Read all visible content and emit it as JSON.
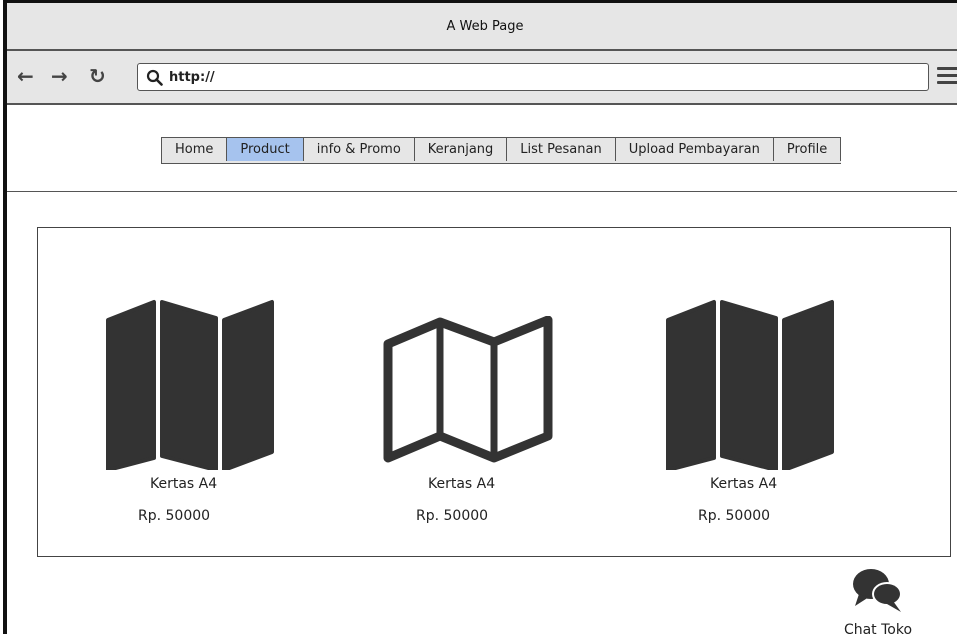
{
  "window": {
    "title": "A Web Page"
  },
  "browser": {
    "url": "http://"
  },
  "nav": {
    "tabs": [
      {
        "label": "Home"
      },
      {
        "label": "Product"
      },
      {
        "label": "info & Promo"
      },
      {
        "label": "Keranjang"
      },
      {
        "label": "List Pesanan"
      },
      {
        "label": "Upload Pembayaran"
      },
      {
        "label": "Profile"
      }
    ],
    "active": "Product"
  },
  "products": [
    {
      "name": "Kertas A4",
      "price": "Rp. 50000",
      "icon": "folded-map-filled-icon"
    },
    {
      "name": "Kertas A4",
      "price": "Rp. 50000",
      "icon": "folded-map-outline-icon"
    },
    {
      "name": "Kertas A4",
      "price": "Rp. 50000",
      "icon": "folded-map-filled-icon"
    }
  ],
  "chat": {
    "label": "Chat Toko",
    "icon": "chat-bubbles-icon"
  },
  "colors": {
    "active_tab": "#a6c3ee",
    "chrome": "#e6e6e6",
    "icon": "#333333"
  }
}
